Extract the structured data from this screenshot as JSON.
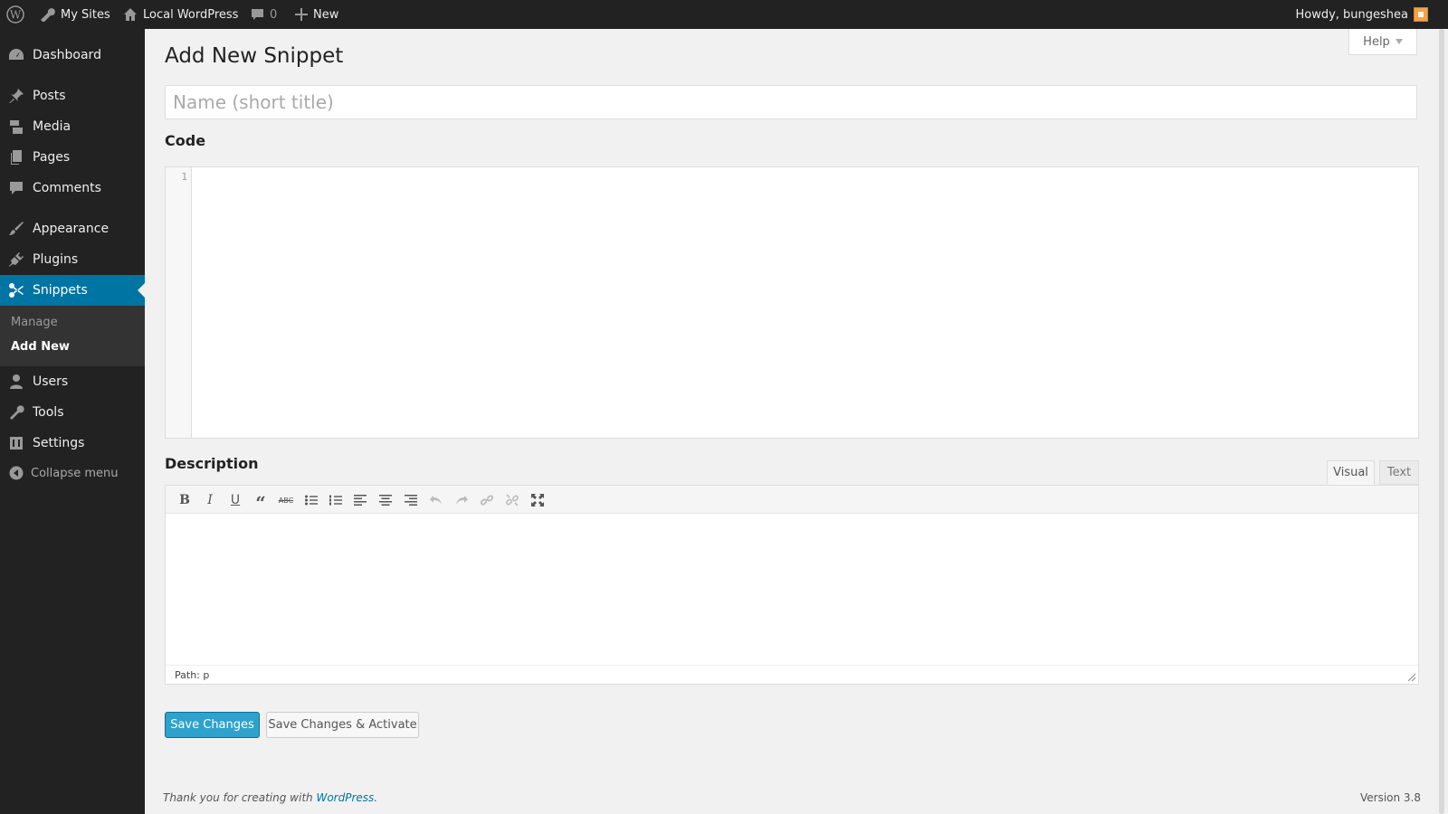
{
  "admin_bar": {
    "my_sites": "My Sites",
    "site_name": "Local WordPress",
    "comments_count": "0",
    "new_label": "New",
    "greeting": "Howdy, bungeshea"
  },
  "sidebar": {
    "items": [
      {
        "label": "Dashboard",
        "icon": "dashboard-icon"
      },
      {
        "label": "Posts",
        "icon": "pin-icon"
      },
      {
        "label": "Media",
        "icon": "media-icon"
      },
      {
        "label": "Pages",
        "icon": "pages-icon"
      },
      {
        "label": "Comments",
        "icon": "comment-bubble-icon"
      },
      {
        "label": "Appearance",
        "icon": "brush-icon"
      },
      {
        "label": "Plugins",
        "icon": "plug-icon"
      },
      {
        "label": "Snippets",
        "icon": "scissors-icon"
      },
      {
        "label": "Users",
        "icon": "user-icon"
      },
      {
        "label": "Tools",
        "icon": "wrench-icon"
      },
      {
        "label": "Settings",
        "icon": "settings-icon"
      }
    ],
    "submenu": [
      "Manage",
      "Add New"
    ],
    "collapse_label": "Collapse menu"
  },
  "help_label": "Help",
  "page_title": "Add New Snippet",
  "name_input": {
    "placeholder": "Name (short title)",
    "value": ""
  },
  "code_label": "Code",
  "code_editor": {
    "line_number": "1"
  },
  "description_label": "Description",
  "editor_tabs": {
    "visual": "Visual",
    "text": "Text"
  },
  "status_path": "Path: p",
  "buttons": {
    "save": "Save Changes",
    "save_activate": "Save Changes & Activate"
  },
  "footer": {
    "thanks_prefix": "Thank you for creating with",
    "link": "WordPress",
    "thanks_suffix": ".",
    "version": "Version 3.8"
  },
  "colors": {
    "accent": "#0074a2",
    "primary_button": "#2ea2cc",
    "sidebar_bg": "#222222"
  }
}
